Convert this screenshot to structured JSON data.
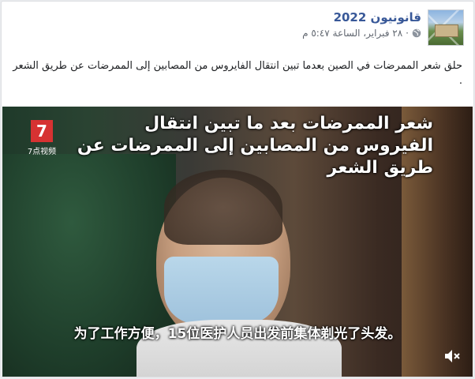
{
  "post": {
    "page_name": "قانونيون 2022",
    "date": "٢٨ فبراير، الساعة ٥:٤٧ م",
    "separator": "·",
    "privacy_icon": "globe-icon",
    "text": "حلق شعر الممرضات في الصين بعدما تبين انتقال الفايروس من المصابين إلى الممرضات عن طريق الشعر ."
  },
  "video": {
    "logo_mark": "7",
    "logo_text": "7点视频",
    "caption_arabic": "شعر الممرضات بعد ما تبين انتقال الفيروس من المصابين إلى الممرضات عن طريق الشعر",
    "caption_chinese": "为了工作方便，15位医护人员出发前集体剃光了头发。",
    "mute_icon": "speaker-muted-icon"
  },
  "colors": {
    "link": "#385898",
    "meta": "#616770",
    "text": "#1c1e21"
  }
}
